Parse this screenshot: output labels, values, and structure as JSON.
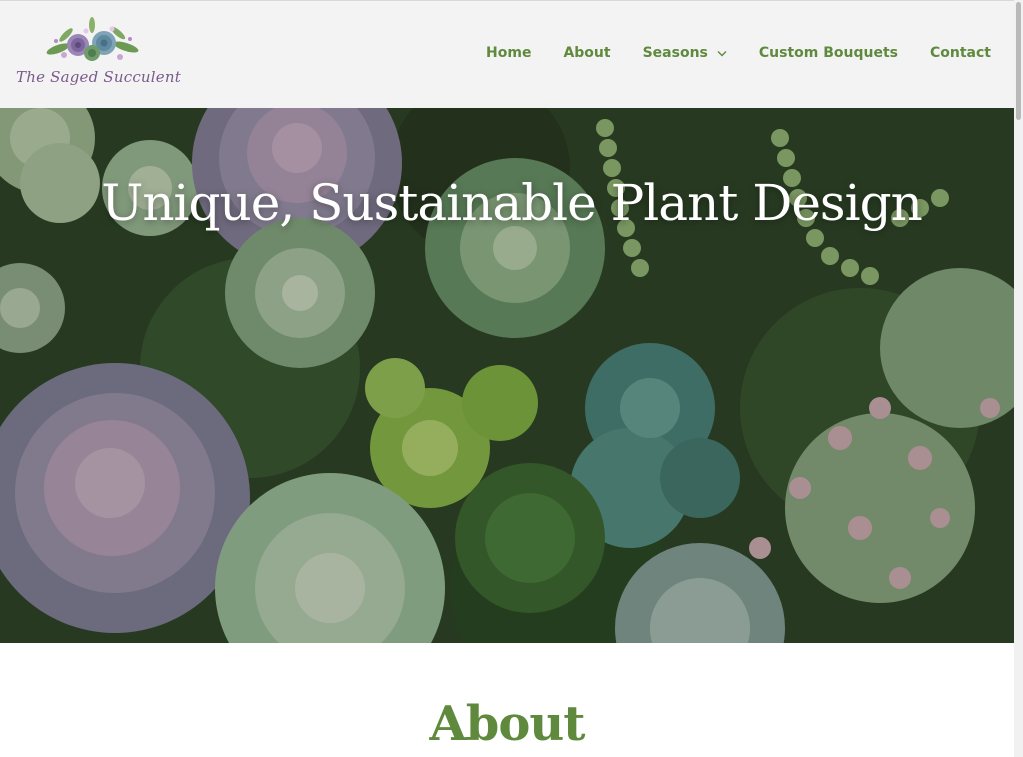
{
  "logo": {
    "text": "The Saged Succulent"
  },
  "nav": {
    "items": [
      {
        "label": "Home"
      },
      {
        "label": "About"
      },
      {
        "label": "Seasons"
      },
      {
        "label": "Custom Bouquets"
      },
      {
        "label": "Contact"
      }
    ]
  },
  "hero": {
    "title": "Unique, Sustainable Plant Design"
  },
  "about": {
    "heading": "About"
  },
  "colors": {
    "accent": "#5f8a3e",
    "header_bg": "#f3f3f3",
    "logo_text": "#7c5a8c"
  },
  "icons": {
    "logo": "succulent-bouquet-icon",
    "seasons_dropdown": "chevron-down-icon"
  }
}
